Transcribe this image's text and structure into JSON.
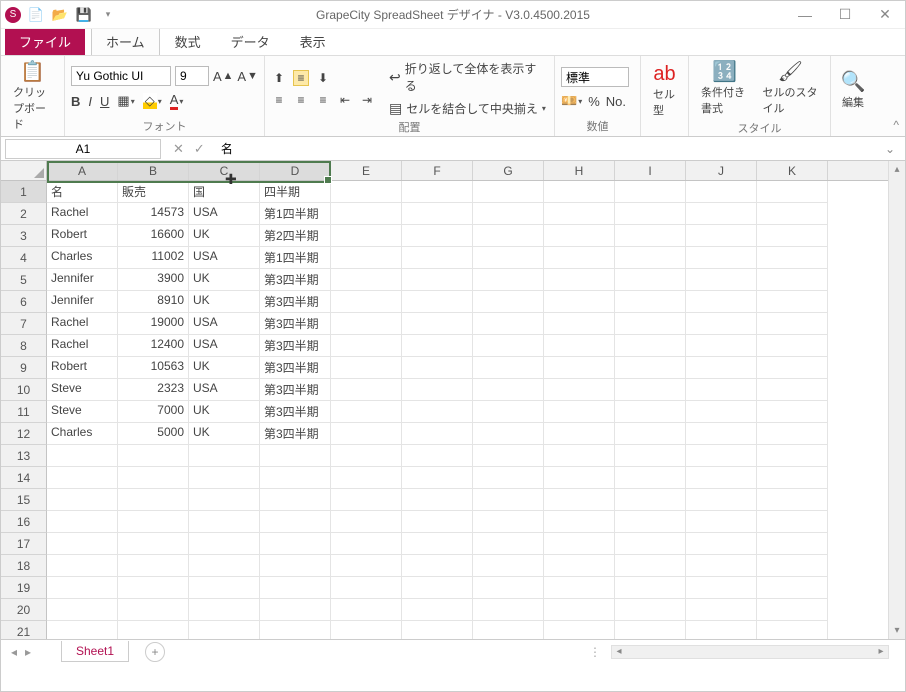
{
  "title": "GrapeCity SpreadSheet デザイナ - V3.0.4500.2015",
  "tabs": {
    "file": "ファイル",
    "home": "ホーム",
    "formula": "数式",
    "data": "データ",
    "view": "表示"
  },
  "ribbon": {
    "clipboard": {
      "paste": "クリップボード"
    },
    "font": {
      "name": "Yu Gothic UI",
      "size": "9",
      "label": "フォント"
    },
    "align": {
      "wrap": "折り返して全体を表示する",
      "merge": "セルを結合して中央揃え",
      "label": "配置"
    },
    "number": {
      "format": "標準",
      "label": "数値"
    },
    "celltype": "セル型",
    "style": {
      "cond": "条件付き書式",
      "cellstyle": "セルのスタイル",
      "label": "スタイル"
    },
    "edit": "編集"
  },
  "namebox": "A1",
  "formula": "名",
  "columns": [
    "A",
    "B",
    "C",
    "D",
    "E",
    "F",
    "G",
    "H",
    "I",
    "J",
    "K"
  ],
  "selColsCount": 4,
  "headers": [
    "名",
    "販売",
    "国",
    "四半期"
  ],
  "data_rows": [
    [
      "Rachel",
      14573,
      "USA",
      "第1四半期"
    ],
    [
      "Robert",
      16600,
      "UK",
      "第2四半期"
    ],
    [
      "Charles",
      11002,
      "USA",
      "第1四半期"
    ],
    [
      "Jennifer",
      3900,
      "UK",
      "第3四半期"
    ],
    [
      "Jennifer",
      8910,
      "UK",
      "第3四半期"
    ],
    [
      "Rachel",
      19000,
      "USA",
      "第3四半期"
    ],
    [
      "Rachel",
      12400,
      "USA",
      "第3四半期"
    ],
    [
      "Robert",
      10563,
      "UK",
      "第3四半期"
    ],
    [
      "Steve",
      2323,
      "USA",
      "第3四半期"
    ],
    [
      "Steve",
      7000,
      "UK",
      "第3四半期"
    ],
    [
      "Charles",
      5000,
      "UK",
      "第3四半期"
    ]
  ],
  "totalRows": 21,
  "sheet": "Sheet1"
}
